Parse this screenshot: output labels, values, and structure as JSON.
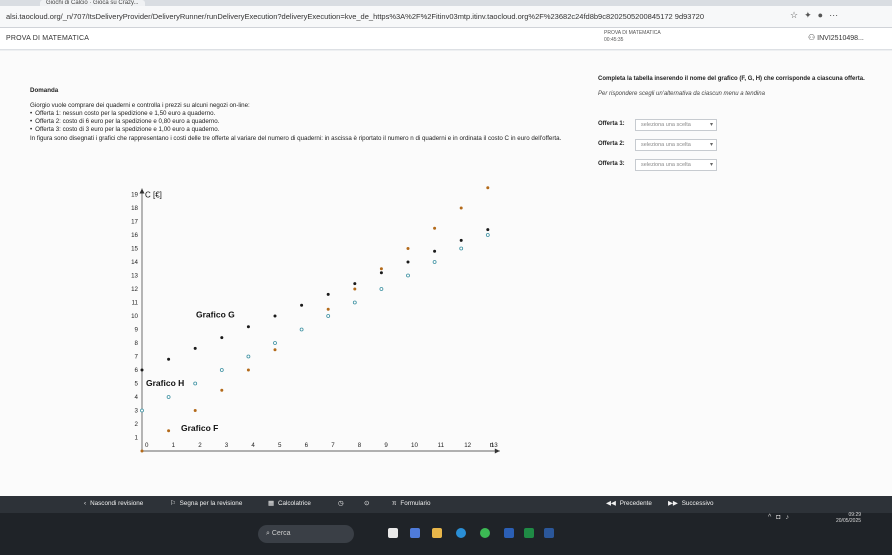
{
  "browser": {
    "tab_label": "Giochi di Calcio · Gioca su Crazy...",
    "url": "alsi.taocloud.org/_n/707/ItsDeliveryProvider/DeliveryRunner/runDeliveryExecution?deliveryExecution=kve_de_https%3A%2F%2Fitinv03mtp.itinv.taocloud.org%2F%23682c24fd8b9c8202505200845172 9d93720"
  },
  "app_header": {
    "title": "PROVA DI MATEMATICA",
    "test_label": "PROVA DI MATEMATICA",
    "timer": "00:45:35",
    "user": "INVI2510498..."
  },
  "question": {
    "domanda_label": "Domanda",
    "intro": "Giorgio vuole comprare dei quaderni e controlla i prezzi su alcuni negozi on-line:",
    "offers": [
      "Offerta 1: nessun costo per la spedizione e 1,50 euro a quaderno.",
      "Offerta 2: costo di 6 euro per la spedizione e 0,80 euro a quaderno.",
      "Offerta 3: costo di 3 euro per la spedizione e 1,00 euro a quaderno."
    ],
    "description": "In figura sono disegnati i grafici che rappresentano i costi delle tre offerte al variare del numero di quaderni: in ascissa è riportato il numero n di quaderni e in ordinata il costo C in euro dell'offerta."
  },
  "chart_data": {
    "type": "scatter",
    "x": [
      0,
      1,
      2,
      3,
      4,
      5,
      6,
      7,
      8,
      9,
      10,
      11,
      12,
      13
    ],
    "xlabel": "n",
    "ylabel": "C [€]",
    "xlim": [
      0,
      13
    ],
    "ylim": [
      0,
      19
    ],
    "grid": false,
    "series": [
      {
        "name": "Grafico G",
        "color": "#b36a1a",
        "marker": "filled",
        "values": [
          0,
          1.5,
          3,
          4.5,
          6,
          7.5,
          9,
          10.5,
          12,
          13.5,
          15,
          16.5,
          18,
          19.5
        ]
      },
      {
        "name": "Grafico H",
        "color": "#3a8fa0",
        "marker": "hollow",
        "values": [
          3,
          4,
          5,
          6,
          7,
          8,
          9,
          10,
          11,
          12,
          13,
          14,
          15,
          16
        ]
      },
      {
        "name": "Grafico F",
        "color": "#1a1a1a",
        "marker": "filled",
        "values": [
          6,
          6.8,
          7.6,
          8.4,
          9.2,
          10,
          10.8,
          11.6,
          12.4,
          13.2,
          14,
          14.8,
          15.6,
          16.4
        ]
      }
    ],
    "annotations": [
      "Grafico G",
      "Grafico H",
      "Grafico F"
    ]
  },
  "right_panel": {
    "instruction": "Completa la tabella inserendo il nome del grafico (F, G, H) che corrisponde a ciascuna offerta.",
    "subinstruction": "Per rispondere scegli un'alternativa da ciascun menu a tendina",
    "rows": [
      {
        "label": "Offerta 1:",
        "placeholder": "seleziona una scelta"
      },
      {
        "label": "Offerta 2:",
        "placeholder": "seleziona una scelta"
      },
      {
        "label": "Offerta 3:",
        "placeholder": "seleziona una scelta"
      }
    ]
  },
  "footer": {
    "hide_review": "Nascondi revisione",
    "flag_review": "Segna per la revisione",
    "calculator": "Calcolatrice",
    "formulary": "Formulario",
    "previous": "Precedente",
    "next": "Successivo"
  },
  "taskbar": {
    "search": "Cerca",
    "time": "09:29",
    "date": "20/05/2025"
  }
}
